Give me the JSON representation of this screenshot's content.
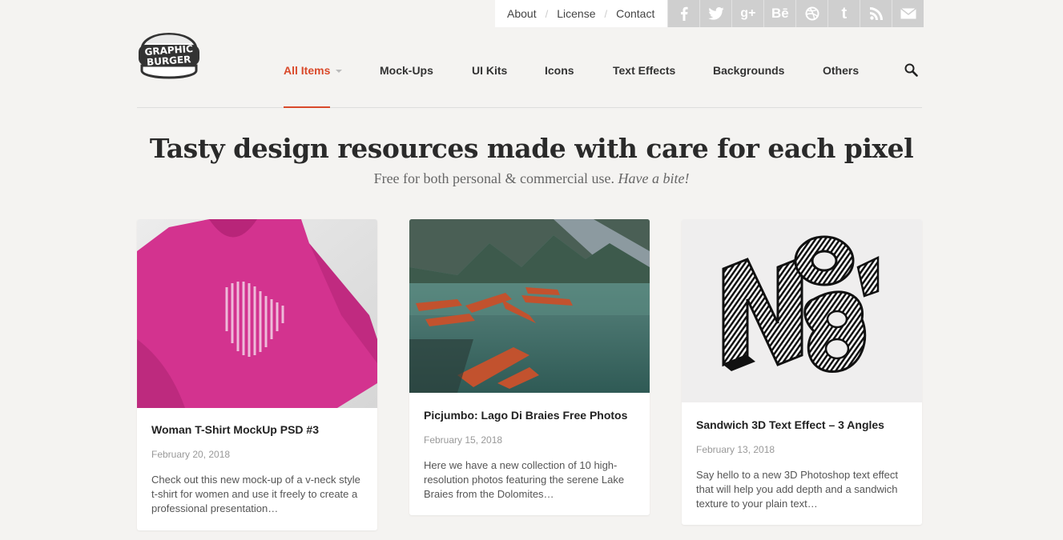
{
  "top_links": [
    "About",
    "License",
    "Contact"
  ],
  "social_icons": [
    "facebook-icon",
    "twitter-icon",
    "google-plus-icon",
    "behance-icon",
    "dribbble-icon",
    "tumblr-icon",
    "rss-icon",
    "mail-icon"
  ],
  "logo": {
    "line1": "GRAPHIC",
    "line2": "BURGER"
  },
  "nav": {
    "items": [
      "All Items",
      "Mock-Ups",
      "UI Kits",
      "Icons",
      "Text Effects",
      "Backgrounds",
      "Others"
    ],
    "accent_color": "#d9492a"
  },
  "hero": {
    "title": "Tasty design resources made with care for each pixel",
    "subtitle": "Free for both personal & commercial use.",
    "subtitle_em": "Have a bite!"
  },
  "cards": [
    {
      "title": "Woman T-Shirt MockUp PSD #3",
      "date": "February 20, 2018",
      "excerpt": "Check out this new mock-up of a v-neck style t-shirt for women and use it freely to create a professional presentation…"
    },
    {
      "title": "Picjumbo: Lago Di Braies Free Photos",
      "date": "February 15, 2018",
      "excerpt": "Here we have a new collection of 10 high-resolution photos featuring the serene Lake Braies from the Dolomites…"
    },
    {
      "title": "Sandwich 3D Text Effect – 3 Angles",
      "date": "February 13, 2018",
      "excerpt": "Say hello to a new 3D Photoshop text effect that will help you add depth and a sandwich texture to your plain text…"
    }
  ]
}
